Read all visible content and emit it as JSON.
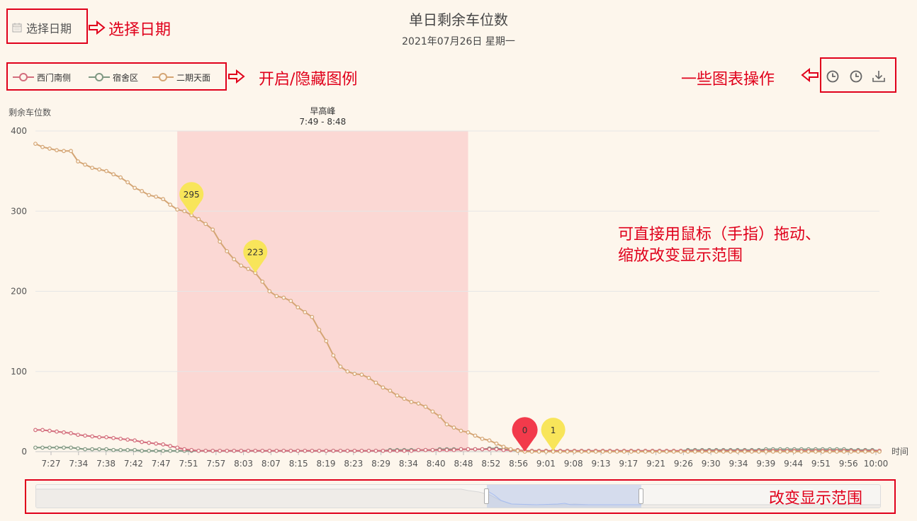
{
  "header": {
    "title": "单日剩余车位数",
    "subtitle": "2021年07月26日 星期一",
    "date_picker_label": "选择日期"
  },
  "annotations": {
    "date_picker": "选择日期",
    "legend_toggle": "开启/隐藏图例",
    "chart_actions": "一些图表操作",
    "drag_zoom_line1": "可直接用鼠标（手指）拖动、",
    "drag_zoom_line2": "缩放改变显示范围",
    "range_slider": "改变显示范围"
  },
  "legend": {
    "items": [
      {
        "label": "西门南侧",
        "color": "#d36d7d"
      },
      {
        "label": "宿舍区",
        "color": "#7f9883"
      },
      {
        "label": "二期天面",
        "color": "#d4a574"
      }
    ]
  },
  "toolbar": {
    "icons": [
      "clock-icon",
      "clock-icon",
      "download-icon"
    ]
  },
  "colors": {
    "background": "#fdf6ec",
    "peak_band": "#fbd8d4",
    "annotation_red": "#e0001b",
    "pin_yellow": "#f8e55a",
    "pin_red": "#f23a4b"
  },
  "chart_data": {
    "type": "line",
    "ylabel": "剩余车位数",
    "xlabel": "时间",
    "ylim": [
      0,
      400
    ],
    "yticks": [
      "0",
      "100",
      "200",
      "300",
      "400"
    ],
    "x_tick_labels": [
      "7:27",
      "7:34",
      "7:38",
      "7:42",
      "7:47",
      "7:51",
      "7:57",
      "8:03",
      "8:07",
      "8:15",
      "8:19",
      "8:23",
      "8:29",
      "8:34",
      "8:40",
      "8:48",
      "8:52",
      "8:56",
      "9:01",
      "9:08",
      "9:13",
      "9:17",
      "9:21",
      "9:26",
      "9:30",
      "9:34",
      "9:39",
      "9:44",
      "9:51",
      "9:56",
      "10:00"
    ],
    "point_count": 120,
    "peak_band": {
      "label": "早高峰",
      "range_label": "7:49 - 8:48",
      "from_index": 20,
      "to_index": 61
    },
    "series": [
      {
        "name": "二期天面",
        "color": "#d4a574",
        "values": [
          384,
          380,
          378,
          376,
          375,
          375,
          362,
          358,
          354,
          352,
          350,
          346,
          342,
          336,
          329,
          325,
          320,
          318,
          315,
          308,
          302,
          300,
          295,
          290,
          284,
          277,
          262,
          250,
          240,
          232,
          228,
          223,
          212,
          200,
          194,
          192,
          188,
          180,
          174,
          168,
          152,
          138,
          120,
          106,
          100,
          97,
          96,
          92,
          86,
          80,
          76,
          70,
          66,
          62,
          60,
          56,
          50,
          44,
          34,
          30,
          26,
          24,
          20,
          16,
          14,
          10,
          6,
          3,
          1,
          0,
          0,
          0,
          0,
          0,
          0,
          0,
          0,
          0,
          0,
          0,
          0,
          0,
          0,
          0,
          0,
          0,
          0,
          0,
          0,
          0,
          0,
          0,
          0,
          0,
          0,
          0,
          0,
          0,
          0,
          0,
          0,
          0,
          0,
          0,
          0,
          0,
          0,
          0,
          0,
          0,
          0,
          0,
          0,
          0,
          0,
          0,
          0,
          0,
          0,
          0
        ]
      },
      {
        "name": "西门南侧",
        "color": "#d36d7d",
        "values": [
          27,
          27,
          26,
          25,
          24,
          23,
          21,
          20,
          19,
          18,
          18,
          17,
          16,
          15,
          14,
          12,
          11,
          10,
          9,
          7,
          5,
          3,
          2,
          1,
          1,
          1,
          1,
          1,
          1,
          1,
          1,
          1,
          1,
          1,
          1,
          1,
          1,
          1,
          1,
          1,
          1,
          1,
          1,
          1,
          1,
          1,
          1,
          1,
          1,
          1,
          1,
          1,
          1,
          1,
          2,
          2,
          2,
          2,
          2,
          2,
          3,
          3,
          3,
          3,
          3,
          3,
          2,
          2,
          2,
          1,
          1,
          1,
          1,
          1,
          1,
          1,
          1,
          1,
          1,
          1,
          1,
          1,
          1,
          1,
          1,
          1,
          1,
          1,
          1,
          1,
          1,
          1,
          1,
          1,
          1,
          1,
          1,
          1,
          1,
          1,
          1,
          1,
          1,
          1,
          1,
          1,
          1,
          1,
          1,
          1,
          1,
          1,
          1,
          1,
          1,
          1,
          1,
          1,
          1,
          1
        ]
      },
      {
        "name": "宿舍区",
        "color": "#7f9883",
        "values": [
          5,
          5,
          5,
          5,
          5,
          5,
          4,
          3,
          3,
          3,
          3,
          2,
          2,
          2,
          2,
          1,
          1,
          1,
          1,
          1,
          1,
          1,
          1,
          1,
          1,
          1,
          1,
          1,
          1,
          1,
          1,
          1,
          1,
          1,
          1,
          1,
          1,
          1,
          1,
          1,
          1,
          1,
          1,
          1,
          1,
          1,
          1,
          1,
          1,
          1,
          2,
          2,
          2,
          2,
          2,
          2,
          2,
          3,
          3,
          3,
          3,
          3,
          3,
          3,
          4,
          4,
          3,
          2,
          1,
          1,
          1,
          1,
          1,
          1,
          1,
          1,
          1,
          1,
          1,
          1,
          1,
          1,
          1,
          1,
          1,
          1,
          1,
          1,
          1,
          1,
          1,
          1,
          2,
          2,
          2,
          2,
          2,
          2,
          2,
          2,
          2,
          2,
          2,
          3,
          3,
          3,
          3,
          3,
          3,
          3,
          3,
          3,
          3,
          3,
          3,
          2,
          2,
          2,
          2,
          1
        ]
      }
    ],
    "markers": [
      {
        "series": "二期天面",
        "index": 22,
        "value": 295,
        "label": "295",
        "color": "#f8e55a"
      },
      {
        "series": "二期天面",
        "index": 31,
        "value": 223,
        "label": "223",
        "color": "#f8e55a"
      },
      {
        "series": "二期天面",
        "index": 69,
        "value": 0,
        "label": "0",
        "color": "#f23a4b"
      },
      {
        "series": "二期天面",
        "index": 73,
        "value": 1,
        "label": "1",
        "color": "#f8e55a"
      }
    ]
  }
}
